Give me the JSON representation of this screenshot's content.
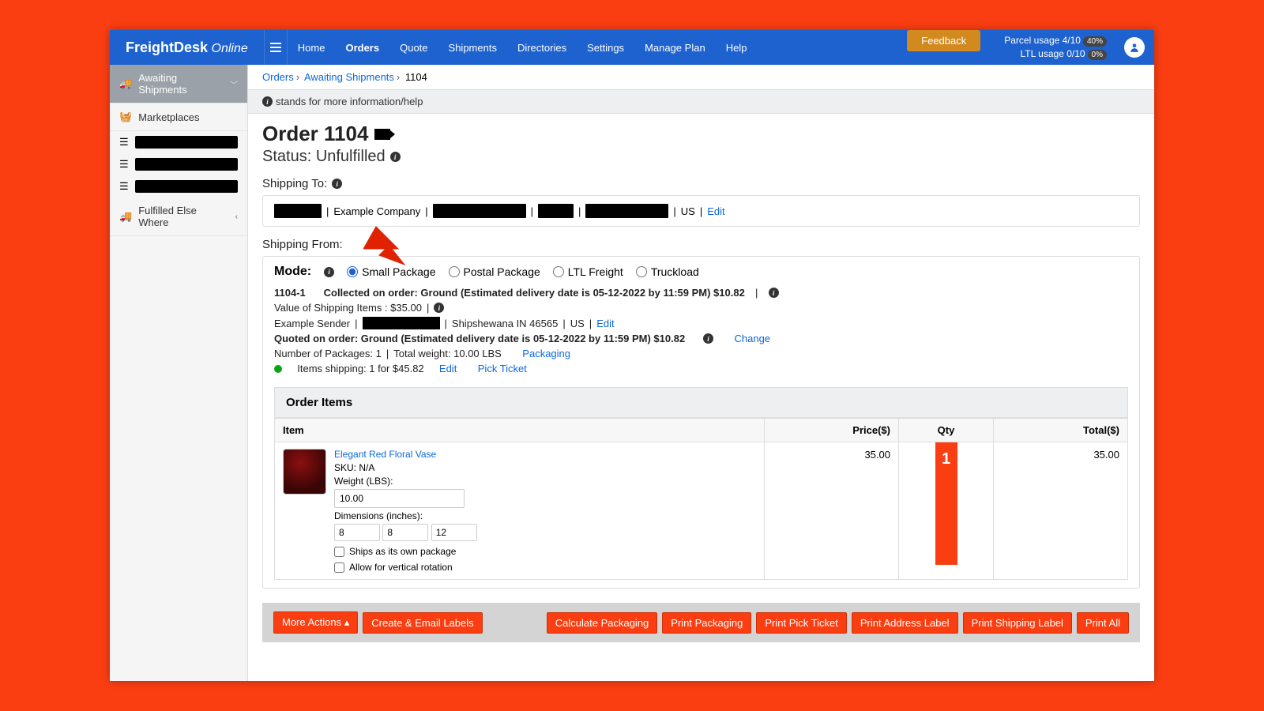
{
  "logo": {
    "a": "FreightDesk",
    "b": "Online"
  },
  "nav": [
    "Home",
    "Orders",
    "Quote",
    "Shipments",
    "Directories",
    "Settings",
    "Manage Plan",
    "Help"
  ],
  "nav_active": "Orders",
  "feedback": "Feedback",
  "usage": {
    "parcel": "Parcel usage 4/10",
    "parcel_pct": "40%",
    "ltl": "LTL usage 0/10",
    "ltl_pct": "0%"
  },
  "sidebar": {
    "awaiting": "Awaiting Shipments",
    "market": "Marketplaces",
    "fulfilled": "Fulfilled Else Where"
  },
  "crumbs": {
    "a": "Orders",
    "b": "Awaiting Shipments",
    "c": "1104"
  },
  "info_hint": "stands for more information/help",
  "title": "Order 1104",
  "status": "Status: Unfulfilled",
  "ship_to": "Shipping To:",
  "ship_to_addr": {
    "company": "Example Company",
    "country": "US",
    "edit": "Edit"
  },
  "ship_from": "Shipping From:",
  "mode": {
    "label": "Mode:",
    "opts": [
      "Small Package",
      "Postal Package",
      "LTL Freight",
      "Truckload"
    ],
    "selected": 0
  },
  "sub": {
    "id": "1104-1",
    "collected": "Collected on order: Ground (Estimated delivery date is 05-12-2022 by 11:59 PM) $10.82",
    "value": "Value of Shipping Items : $35.00",
    "sender": "Example Sender",
    "loc": "Shipshewana IN 46565",
    "country": "US",
    "quoted": "Quoted on order: Ground (Estimated delivery date is 05-12-2022 by 11:59 PM) $10.82",
    "pkgs": "Number of Packages: 1",
    "weight": "Total weight: 10.00 LBS",
    "packaging": "Packaging",
    "items_ship": "Items shipping: 1 for $45.82",
    "edit": "Edit",
    "pick": "Pick Ticket",
    "change": "Change"
  },
  "items": {
    "head": "Order Items",
    "cols": [
      "Item",
      "Price($)",
      "Qty",
      "Total($)"
    ],
    "row": {
      "name": "Elegant Red Floral Vase",
      "sku": "SKU: N/A",
      "wlabel": "Weight (LBS):",
      "w": "10.00",
      "dlabel": "Dimensions (inches):",
      "d1": "8",
      "d2": "8",
      "d3": "12",
      "own": "Ships as its own package",
      "rot": "Allow for vertical rotation",
      "price": "35.00",
      "qty": "1",
      "total": "35.00"
    }
  },
  "footer": [
    "More Actions",
    "Create & Email Labels",
    "Calculate Packaging",
    "Print Packaging",
    "Print Pick Ticket",
    "Print Address Label",
    "Print Shipping Label",
    "Print All"
  ]
}
